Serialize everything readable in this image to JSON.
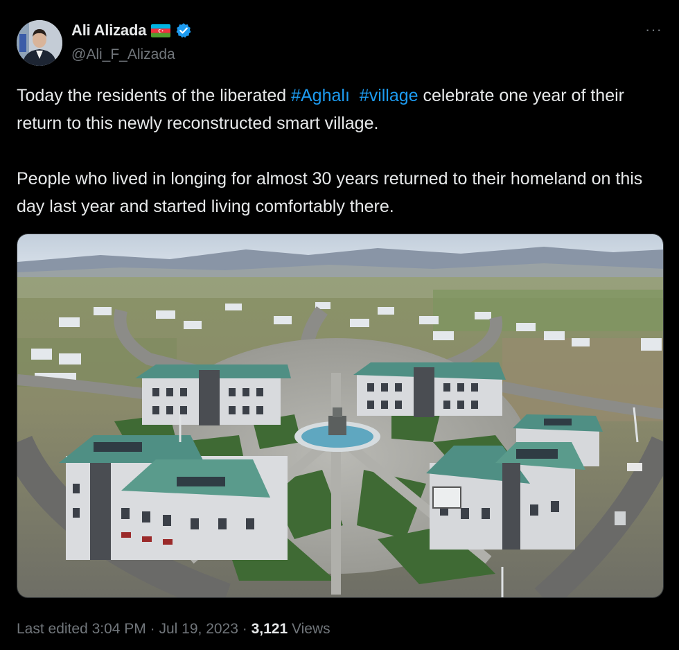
{
  "author": {
    "display_name": "Ali Alizada",
    "handle": "@Ali_F_Alizada",
    "flag_icon": "azerbaijan-flag-icon",
    "verified_icon": "verified-badge-icon"
  },
  "menu": {
    "more_label": "···"
  },
  "tweet": {
    "para1_before": "Today the residents of the liberated ",
    "hashtag1": "#Aghalı",
    "hashtag2": "#village",
    "para1_after": " celebrate one year of their return to this newly reconstructed smart village.",
    "para2": "People who lived in longing for almost 30 years returned to their homeland on this day last year and started living comfortably there."
  },
  "media": {
    "type": "aerial-photo-village"
  },
  "meta": {
    "edited_label": "Last edited",
    "time": "3:04 PM",
    "date": "Jul 19, 2023",
    "views_count": "3,121",
    "views_label": "Views"
  },
  "colors": {
    "background": "#000000",
    "link": "#1d9bf0",
    "text": "#e7e9ea",
    "muted": "#71767b",
    "verified": "#1d9bf0"
  }
}
